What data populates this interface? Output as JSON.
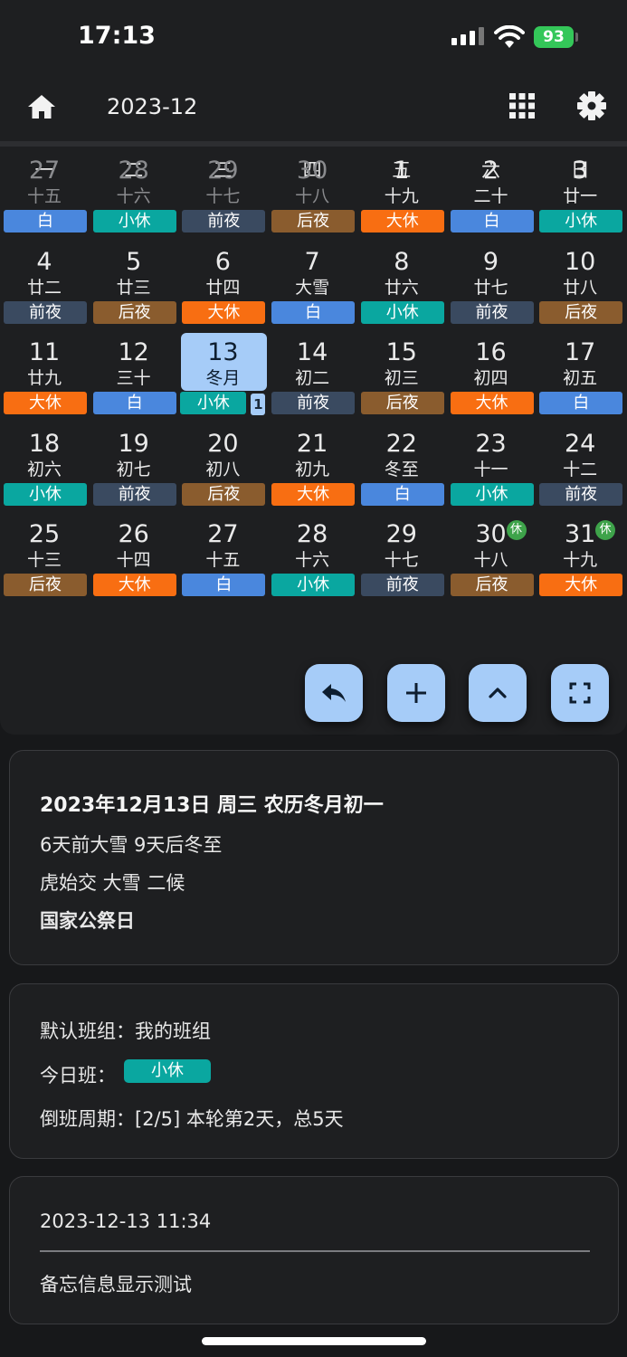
{
  "status_bar": {
    "time": "17:13",
    "battery": "93"
  },
  "header": {
    "month": "2023-12",
    "icons": [
      "home-icon",
      "grid-icon",
      "gear-icon"
    ]
  },
  "weekdays": [
    "一",
    "二",
    "三",
    "四",
    "五",
    "六",
    "日"
  ],
  "shift_colors": {
    "白": "#4a87dd",
    "小休": "#0aa7a0",
    "前夜": "#3a4a60",
    "后夜": "#8a5c2e",
    "大休": "#f86e12"
  },
  "days": [
    {
      "day": "27",
      "lunar": "十五",
      "shift": "白",
      "other": true
    },
    {
      "day": "28",
      "lunar": "十六",
      "shift": "小休",
      "other": true
    },
    {
      "day": "29",
      "lunar": "十七",
      "shift": "前夜",
      "other": true
    },
    {
      "day": "30",
      "lunar": "十八",
      "shift": "后夜",
      "other": true
    },
    {
      "day": "1",
      "lunar": "十九",
      "shift": "大休"
    },
    {
      "day": "2",
      "lunar": "二十",
      "shift": "白"
    },
    {
      "day": "3",
      "lunar": "廿一",
      "shift": "小休"
    },
    {
      "day": "4",
      "lunar": "廿二",
      "shift": "前夜"
    },
    {
      "day": "5",
      "lunar": "廿三",
      "shift": "后夜"
    },
    {
      "day": "6",
      "lunar": "廿四",
      "shift": "大休"
    },
    {
      "day": "7",
      "lunar": "大雪",
      "shift": "白"
    },
    {
      "day": "8",
      "lunar": "廿六",
      "shift": "小休"
    },
    {
      "day": "9",
      "lunar": "廿七",
      "shift": "前夜"
    },
    {
      "day": "10",
      "lunar": "廿八",
      "shift": "后夜"
    },
    {
      "day": "11",
      "lunar": "廿九",
      "shift": "大休"
    },
    {
      "day": "12",
      "lunar": "三十",
      "shift": "白"
    },
    {
      "day": "13",
      "lunar": "冬月",
      "shift": "小休",
      "selected": true,
      "memo_count": "1"
    },
    {
      "day": "14",
      "lunar": "初二",
      "shift": "前夜"
    },
    {
      "day": "15",
      "lunar": "初三",
      "shift": "后夜"
    },
    {
      "day": "16",
      "lunar": "初四",
      "shift": "大休"
    },
    {
      "day": "17",
      "lunar": "初五",
      "shift": "白"
    },
    {
      "day": "18",
      "lunar": "初六",
      "shift": "小休"
    },
    {
      "day": "19",
      "lunar": "初七",
      "shift": "前夜"
    },
    {
      "day": "20",
      "lunar": "初八",
      "shift": "后夜"
    },
    {
      "day": "21",
      "lunar": "初九",
      "shift": "大休"
    },
    {
      "day": "22",
      "lunar": "冬至",
      "shift": "白"
    },
    {
      "day": "23",
      "lunar": "十一",
      "shift": "小休"
    },
    {
      "day": "24",
      "lunar": "十二",
      "shift": "前夜"
    },
    {
      "day": "25",
      "lunar": "十三",
      "shift": "后夜"
    },
    {
      "day": "26",
      "lunar": "十四",
      "shift": "大休"
    },
    {
      "day": "27",
      "lunar": "十五",
      "shift": "白"
    },
    {
      "day": "28",
      "lunar": "十六",
      "shift": "小休"
    },
    {
      "day": "29",
      "lunar": "十七",
      "shift": "前夜"
    },
    {
      "day": "30",
      "lunar": "十八",
      "shift": "后夜",
      "holiday": "休"
    },
    {
      "day": "31",
      "lunar": "十九",
      "shift": "大休",
      "holiday": "休"
    }
  ],
  "fab_icons": [
    "undo-icon",
    "plus-icon",
    "chevron-up-icon",
    "fullscreen-icon"
  ],
  "detail": {
    "title": "2023年12月13日 周三 农历冬月初一",
    "solar_terms": "6天前大雪   9天后冬至",
    "phenology": "虎始交 大雪 二候",
    "festival": "国家公祭日"
  },
  "shift_info": {
    "group": "默认班组：我的班组",
    "today_label": "今日班：",
    "today_shift": "小休",
    "cycle": "倒班周期：[2/5] 本轮第2天，总5天"
  },
  "memo": {
    "timestamp": "2023-12-13 11:34",
    "text": "备忘信息显示测试"
  }
}
